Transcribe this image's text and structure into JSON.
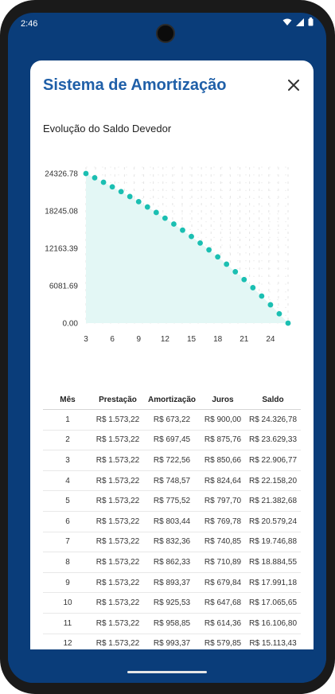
{
  "status": {
    "time": "2:46"
  },
  "modal": {
    "title": "Sistema de Amortização"
  },
  "chart_data": {
    "type": "area",
    "title": "Evolução do Saldo Devedor",
    "xlabel": "",
    "ylabel": "",
    "x_ticks": [
      3,
      6,
      9,
      12,
      15,
      18,
      21,
      24
    ],
    "y_ticks": [
      "0.00",
      "6081.69",
      "12163.39",
      "18245.08",
      "24326.78"
    ],
    "ylim": [
      0,
      24326.78
    ],
    "xlim": [
      3,
      26
    ],
    "x": [
      3,
      4,
      5,
      6,
      7,
      8,
      9,
      10,
      11,
      12,
      13,
      14,
      15,
      16,
      17,
      18,
      19,
      20,
      21,
      22,
      23,
      24,
      25,
      26
    ],
    "values": [
      24326.78,
      23629.33,
      22906.77,
      22158.2,
      21382.68,
      20579.24,
      19746.88,
      18884.55,
      17991.18,
      17065.65,
      16106.8,
      15113.43,
      14084.3,
      13018.1,
      11913.5,
      10769.1,
      9583.5,
      8355.2,
      7082.7,
      5764.4,
      4398.6,
      2983.6,
      1517.7,
      0.0
    ],
    "grid": true,
    "color": "#1bbfb2",
    "fill": "#e3f7f5"
  },
  "table": {
    "headers": [
      "Mês",
      "Prestação",
      "Amortização",
      "Juros",
      "Saldo"
    ],
    "rows": [
      [
        "1",
        "R$ 1.573,22",
        "R$ 673,22",
        "R$ 900,00",
        "R$ 24.326,78"
      ],
      [
        "2",
        "R$ 1.573,22",
        "R$ 697,45",
        "R$ 875,76",
        "R$ 23.629,33"
      ],
      [
        "3",
        "R$ 1.573,22",
        "R$ 722,56",
        "R$ 850,66",
        "R$ 22.906,77"
      ],
      [
        "4",
        "R$ 1.573,22",
        "R$ 748,57",
        "R$ 824,64",
        "R$ 22.158,20"
      ],
      [
        "5",
        "R$ 1.573,22",
        "R$ 775,52",
        "R$ 797,70",
        "R$ 21.382,68"
      ],
      [
        "6",
        "R$ 1.573,22",
        "R$ 803,44",
        "R$ 769,78",
        "R$ 20.579,24"
      ],
      [
        "7",
        "R$ 1.573,22",
        "R$ 832,36",
        "R$ 740,85",
        "R$ 19.746,88"
      ],
      [
        "8",
        "R$ 1.573,22",
        "R$ 862,33",
        "R$ 710,89",
        "R$ 18.884,55"
      ],
      [
        "9",
        "R$ 1.573,22",
        "R$ 893,37",
        "R$ 679,84",
        "R$ 17.991,18"
      ],
      [
        "10",
        "R$ 1.573,22",
        "R$ 925,53",
        "R$ 647,68",
        "R$ 17.065,65"
      ],
      [
        "11",
        "R$ 1.573,22",
        "R$ 958,85",
        "R$ 614,36",
        "R$ 16.106,80"
      ],
      [
        "12",
        "R$ 1.573,22",
        "R$ 993,37",
        "R$ 579,85",
        "R$ 15.113,43"
      ]
    ]
  }
}
